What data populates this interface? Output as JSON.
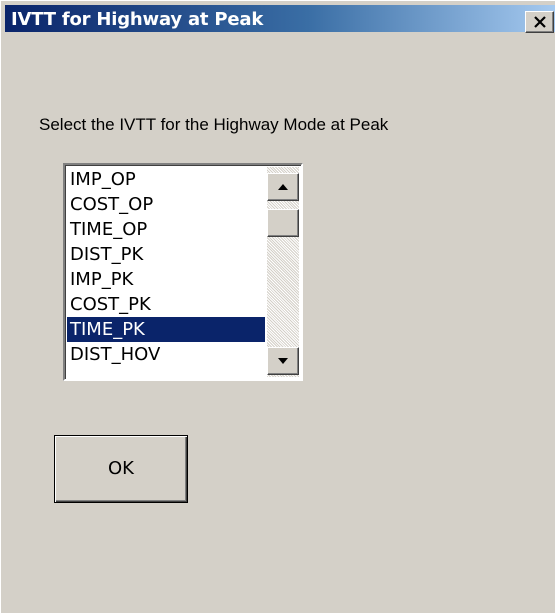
{
  "window": {
    "title": "IVTT for Highway at Peak",
    "close_label": "×"
  },
  "main": {
    "prompt": "Select the IVTT for the Highway Mode at Peak",
    "listbox": {
      "items": [
        "IMP_OP",
        "COST_OP",
        "TIME_OP",
        "DIST_PK",
        "IMP_PK",
        "COST_PK",
        "TIME_PK",
        "DIST_HOV"
      ],
      "selected": "TIME_PK"
    },
    "ok_label": "OK"
  },
  "colors": {
    "dialog_bg": "#d4d0c8",
    "titlebar_start": "#0a246a",
    "titlebar_end": "#a6caf0",
    "selection_bg": "#0a246a",
    "selection_text": "#ffffff"
  },
  "icons": {
    "close": "close-icon",
    "scroll_up": "scroll-up-arrow-icon",
    "scroll_down": "scroll-down-arrow-icon"
  }
}
